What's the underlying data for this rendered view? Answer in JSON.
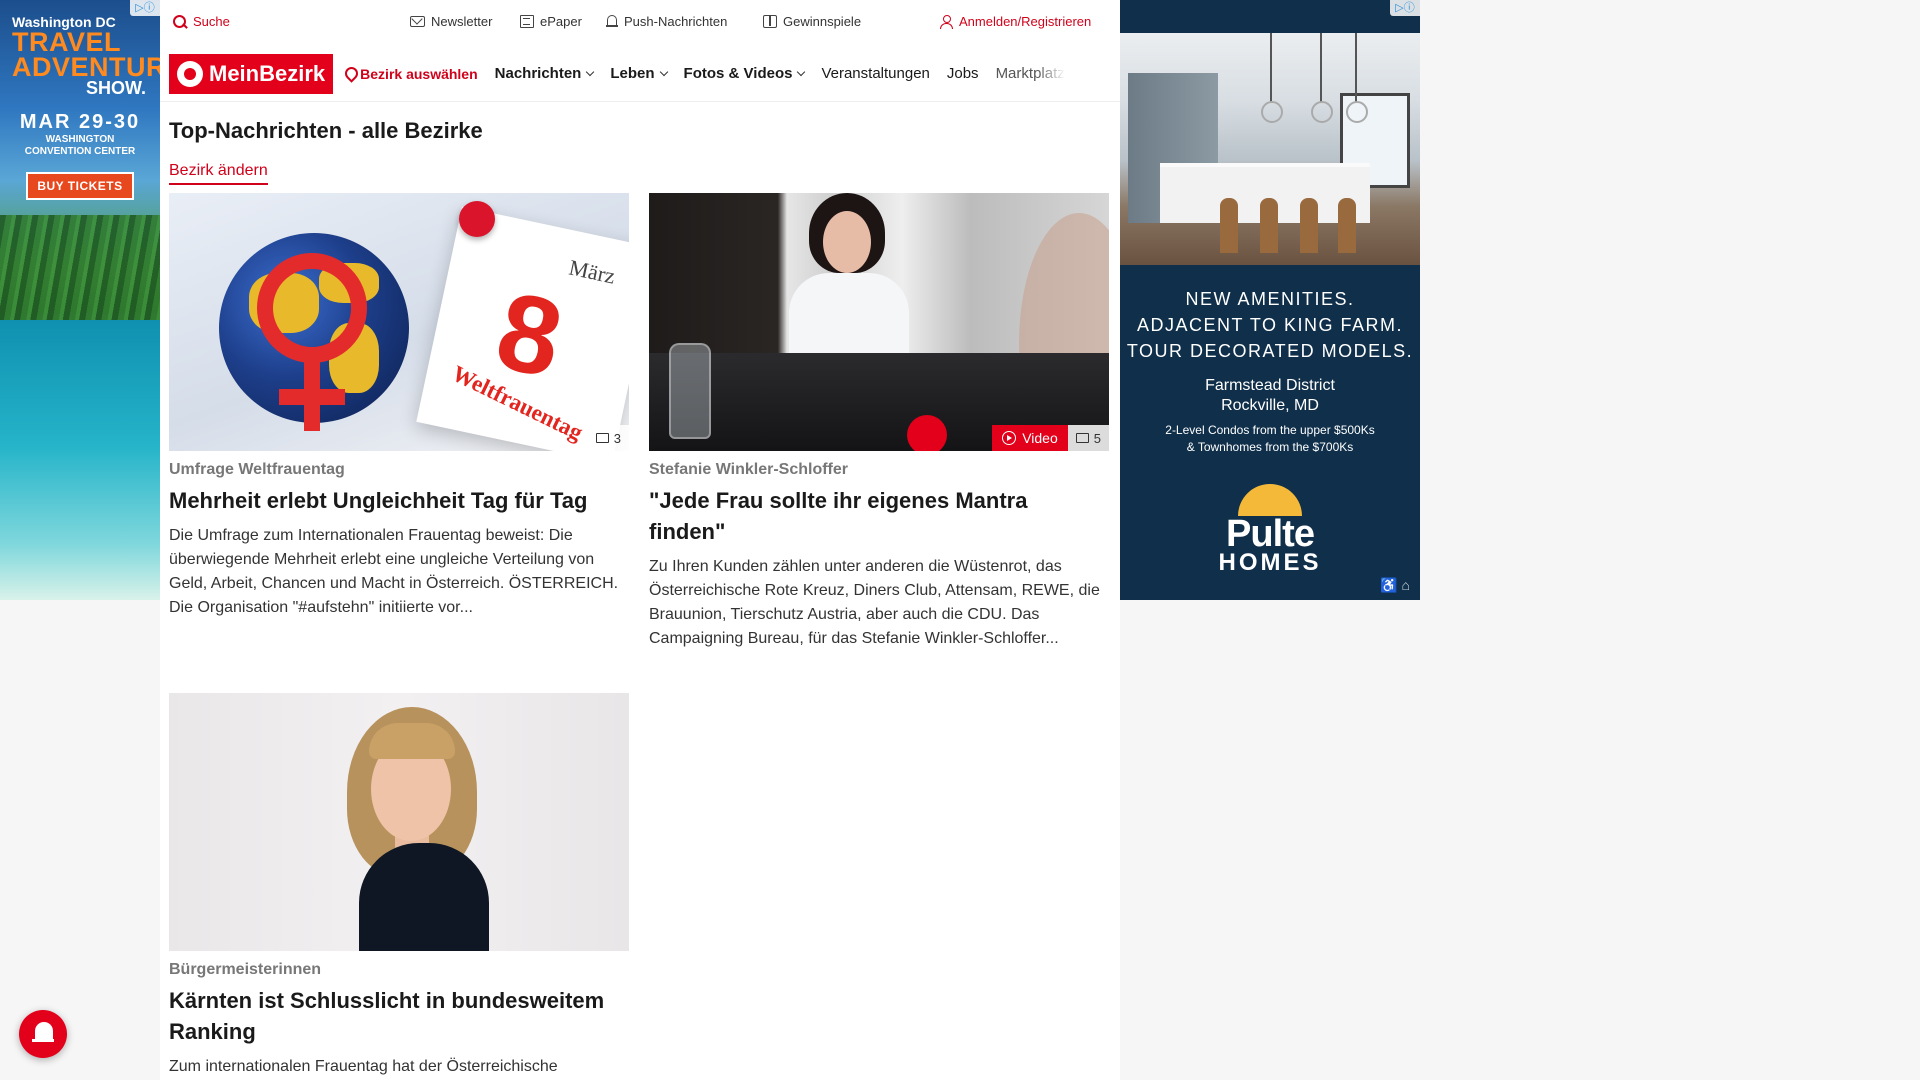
{
  "topbar": {
    "search": "Suche",
    "newsletter": "Newsletter",
    "epaper": "ePaper",
    "push": "Push-Nachrichten",
    "gewinnspiele": "Gewinnspiele",
    "login": "Anmelden/Registrieren"
  },
  "brand": {
    "name": "MeinBezirk"
  },
  "nav": {
    "bezirk": "Bezirk auswählen",
    "items": [
      "Nachrichten",
      "Leben",
      "Fotos & Videos",
      "Veranstaltungen",
      "Jobs",
      "Marktplatz"
    ]
  },
  "section": {
    "title": "Top-Nachrichten - alle Bezirke",
    "change": "Bezirk ändern"
  },
  "articles": [
    {
      "kicker": "Umfrage Weltfrauentag",
      "title": "Mehrheit erlebt Ungleichheit Tag für Tag",
      "teaser": "Die Umfrage zum Internationalen Frauentag beweist: Die überwiegende Mehrheit erlebt eine ungleiche Verteilung von Geld, Arbeit, Chancen und Macht in Österreich. ÖSTERREICH. Die Organisation \"#aufstehn\" initiierte vor...",
      "photo_count": "3",
      "image_text": {
        "month": "März",
        "day": "8",
        "label": "Weltfrauentag"
      }
    },
    {
      "kicker": "Stefanie Winkler-Schloffer",
      "title": "\"Jede Frau sollte ihr eigenes Mantra finden\"",
      "teaser": "Zu Ihren Kunden zählen unter anderen die Wüstenrot, das Österreichische Rote Kreuz, Diners Club, Attensam, REWE, die Brauunion, Tierschutz Austria, aber auch die CDU. Das Campaigning Bureau, für das Stefanie Winkler-Schloffer...",
      "video_label": "Video",
      "photo_count": "5"
    },
    {
      "kicker": "Bürgermeisterinnen",
      "title": "Kärnten ist Schlusslicht in bundesweitem Ranking",
      "teaser": "Zum internationalen Frauentag hat der Österreichische"
    }
  ],
  "ad_left": {
    "line1": "Washington DC",
    "line2a": "TRAVEL",
    "line2b": "ADVENTURE",
    "line3": "SHOW.",
    "dates": "MAR 29-30",
    "venue1": "WASHINGTON",
    "venue2": "CONVENTION CENTER",
    "cta": "BUY TICKETS"
  },
  "ad_right": {
    "headline1": "NEW AMENITIES.",
    "headline2": "ADJACENT TO KING FARM.",
    "headline3": "TOUR DECORATED MODELS.",
    "place1": "Farmstead District",
    "place2": "Rockville, MD",
    "price1": "2-Level Condos from the upper $500Ks",
    "price2": "& Townhomes from the $700Ks",
    "logo1": "Pulte",
    "logo2": "HOMES"
  },
  "colors": {
    "brand_red": "#e2001a",
    "ad_navy": "#0f2f4a"
  }
}
